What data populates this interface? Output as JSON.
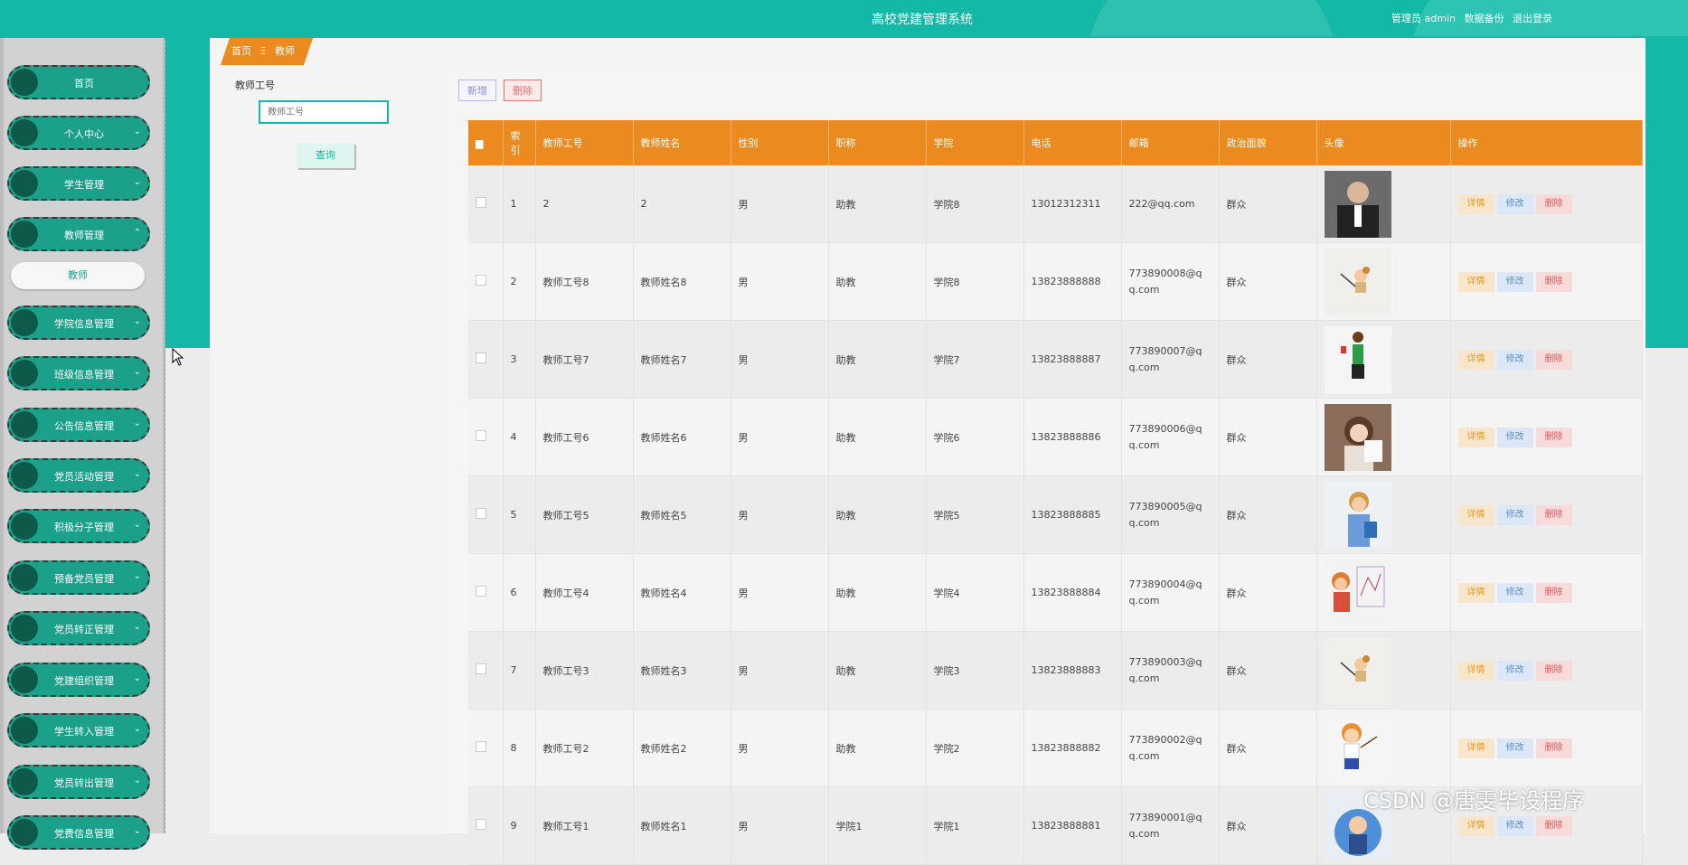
{
  "header": {
    "title": "高校党建管理系统",
    "user_label": "管理员 admin",
    "backup_label": "数据备份",
    "logout_label": "退出登录"
  },
  "sidebar": {
    "items": [
      {
        "label": "首页",
        "chevron": ""
      },
      {
        "label": "个人中心",
        "chevron": "⌄"
      },
      {
        "label": "学生管理",
        "chevron": "⌄"
      },
      {
        "label": "教师管理",
        "chevron": "⌃"
      },
      {
        "label": "学院信息管理",
        "chevron": "⌄"
      },
      {
        "label": "班级信息管理",
        "chevron": "⌄"
      },
      {
        "label": "公告信息管理",
        "chevron": "⌄"
      },
      {
        "label": "党员活动管理",
        "chevron": "⌄"
      },
      {
        "label": "积极分子管理",
        "chevron": "⌄"
      },
      {
        "label": "预备党员管理",
        "chevron": "⌄"
      },
      {
        "label": "党员转正管理",
        "chevron": "⌄"
      },
      {
        "label": "党建组织管理",
        "chevron": "⌄"
      },
      {
        "label": "学生转入管理",
        "chevron": "⌄"
      },
      {
        "label": "党员转出管理",
        "chevron": "⌄"
      },
      {
        "label": "党费信息管理",
        "chevron": "⌄"
      }
    ],
    "subitem": "教师"
  },
  "breadcrumb": {
    "home": "首页",
    "sep": "Ξ",
    "current": "教师"
  },
  "search": {
    "label": "教师工号",
    "placeholder": "教师工号",
    "button": "查询"
  },
  "toolbar": {
    "add": "新增",
    "delete": "删除"
  },
  "table": {
    "headers": [
      "▆",
      "索引",
      "教师工号",
      "教师姓名",
      "性别",
      "职称",
      "学院",
      "电话",
      "邮箱",
      "政治面貌",
      "头像",
      "操作"
    ],
    "rows": [
      {
        "idx": "1",
        "no": "2",
        "name": "2",
        "sex": "男",
        "title": "助教",
        "college": "学院8",
        "phone": "13012312311",
        "email": "222@qq.com",
        "political": "群众",
        "avatar": "photo-man"
      },
      {
        "idx": "2",
        "no": "教师工号8",
        "name": "教师姓名8",
        "sex": "男",
        "title": "助教",
        "college": "学院8",
        "phone": "13823888888",
        "email": "773890008@qq.com",
        "political": "群众",
        "avatar": "cartoon-teacher"
      },
      {
        "idx": "3",
        "no": "教师工号7",
        "name": "教师姓名7",
        "sex": "男",
        "title": "助教",
        "college": "学院7",
        "phone": "13823888887",
        "email": "773890007@qq.com",
        "political": "群众",
        "avatar": "cartoon-woman-red"
      },
      {
        "idx": "4",
        "no": "教师工号6",
        "name": "教师姓名6",
        "sex": "男",
        "title": "助教",
        "college": "学院6",
        "phone": "13823888886",
        "email": "773890006@qq.com",
        "political": "群众",
        "avatar": "photo-woman"
      },
      {
        "idx": "5",
        "no": "教师工号5",
        "name": "教师姓名5",
        "sex": "男",
        "title": "助教",
        "college": "学院5",
        "phone": "13823888885",
        "email": "773890005@qq.com",
        "political": "群众",
        "avatar": "cartoon-woman-blue"
      },
      {
        "idx": "6",
        "no": "教师工号4",
        "name": "教师姓名4",
        "sex": "男",
        "title": "助教",
        "college": "学院4",
        "phone": "13823888884",
        "email": "773890004@qq.com",
        "political": "群众",
        "avatar": "cartoon-boy"
      },
      {
        "idx": "7",
        "no": "教师工号3",
        "name": "教师姓名3",
        "sex": "男",
        "title": "助教",
        "college": "学院3",
        "phone": "13823888883",
        "email": "773890003@qq.com",
        "political": "群众",
        "avatar": "cartoon-teacher"
      },
      {
        "idx": "8",
        "no": "教师工号2",
        "name": "教师姓名2",
        "sex": "男",
        "title": "助教",
        "college": "学院2",
        "phone": "13823888882",
        "email": "773890002@qq.com",
        "political": "群众",
        "avatar": "cartoon-girl"
      },
      {
        "idx": "9",
        "no": "教师工号1",
        "name": "教师姓名1",
        "sex": "男",
        "title": "学院1",
        "college": "学院1",
        "phone": "13823888881",
        "email": "773890001@qq.com",
        "political": "群众",
        "avatar": "cartoon-man"
      }
    ],
    "actions": {
      "detail": "详情",
      "edit": "修改",
      "delete": "删除"
    }
  },
  "watermark": "CSDN @唐雯毕设程序",
  "colors": {
    "header": "#14b8a6",
    "table_header": "#ea8a1f",
    "menu": "#1ba089"
  }
}
